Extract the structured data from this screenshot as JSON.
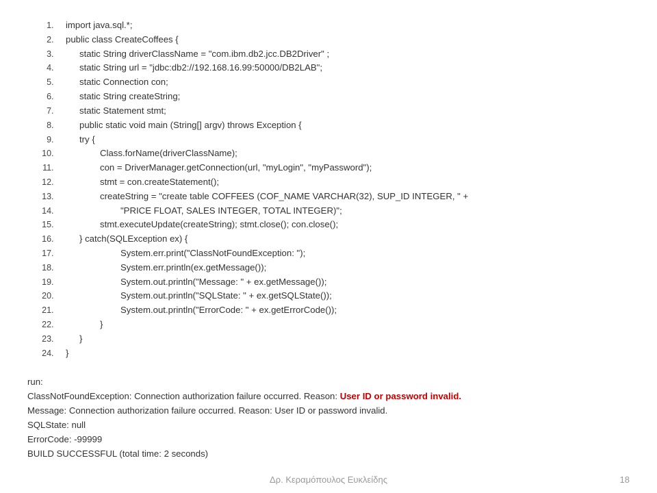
{
  "code": [
    {
      "indent": 0,
      "text": "import java.sql.*;"
    },
    {
      "indent": 0,
      "text": "public class CreateCoffees {"
    },
    {
      "indent": 1,
      "text": "static String    driverClassName = \"com.ibm.db2.jcc.DB2Driver\" ;"
    },
    {
      "indent": 1,
      "text": "static String url = \"jdbc:db2://192.168.16.99:50000/DB2LAB\";"
    },
    {
      "indent": 1,
      "text": "static Connection con;"
    },
    {
      "indent": 1,
      "text": "static String createString;"
    },
    {
      "indent": 1,
      "text": "static Statement stmt;"
    },
    {
      "indent": 1,
      "text": "public static void main (String[] argv) throws Exception {"
    },
    {
      "indent": 1,
      "text": "try {"
    },
    {
      "indent": 2,
      "text": "Class.forName(driverClassName);"
    },
    {
      "indent": 2,
      "text": "con = DriverManager.getConnection(url, \"myLogin\", \"myPassword\");"
    },
    {
      "indent": 2,
      "text": "stmt = con.createStatement();"
    },
    {
      "indent": 2,
      "text": "createString = \"create table COFFEES (COF_NAME VARCHAR(32), SUP_ID INTEGER, \" +"
    },
    {
      "indent": 3,
      "text": "\"PRICE FLOAT, SALES INTEGER, TOTAL INTEGER)\";"
    },
    {
      "indent": 2,
      "text": "stmt.executeUpdate(createString);   stmt.close();    con.close();"
    },
    {
      "indent": 1,
      "text": "} catch(SQLException ex) {"
    },
    {
      "indent": 3,
      "text": "System.err.print(\"ClassNotFoundException: \");"
    },
    {
      "indent": 3,
      "text": "System.err.println(ex.getMessage());"
    },
    {
      "indent": 3,
      "text": "System.out.println(\"Message: \" + ex.getMessage());"
    },
    {
      "indent": 3,
      "text": "System.out.println(\"SQLState: \" + ex.getSQLState());"
    },
    {
      "indent": 3,
      "text": "System.out.println(\"ErrorCode: \" + ex.getErrorCode());"
    },
    {
      "indent": 2,
      "text": "}"
    },
    {
      "indent": 1,
      "text": "}"
    },
    {
      "indent": 0,
      "text": "}"
    }
  ],
  "output": {
    "run": "run:",
    "line1a": "ClassNotFoundException: Connection authorization failure occurred.  Reason: ",
    "line1b": "User ID or password invalid.",
    "line2": "Message: Connection authorization failure occurred.  Reason: User ID or password invalid.",
    "line3": "SQLState: null",
    "line4": "ErrorCode: -99999",
    "line5": "BUILD SUCCESSFUL (total time: 2 seconds)"
  },
  "footer": {
    "center": "Δρ. Κεραμόπουλος Ευκλείδης",
    "page": "18"
  }
}
